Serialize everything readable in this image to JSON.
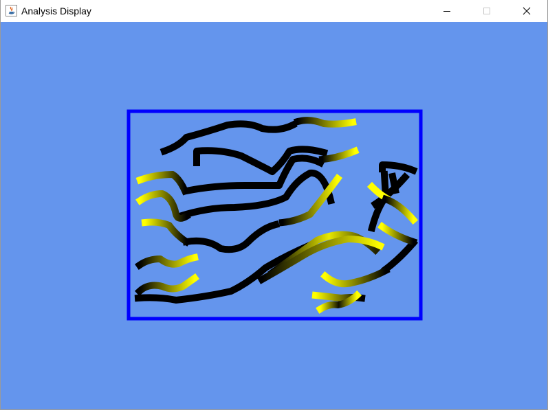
{
  "window": {
    "title": "Analysis Display",
    "app_icon": "java-icon",
    "controls": [
      "minimize-icon",
      "maximize-icon",
      "close-icon"
    ]
  },
  "colors": {
    "background": "#6495ed",
    "frame": "#0000ff",
    "stroke_dark": "#000000",
    "stroke_light": "#ffff00"
  }
}
